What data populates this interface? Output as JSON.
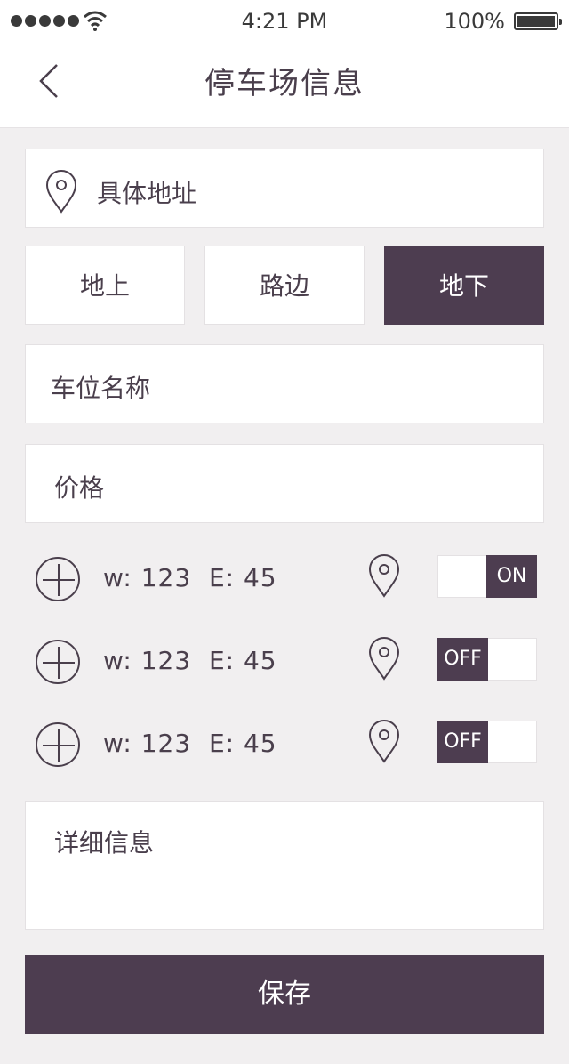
{
  "status_bar": {
    "time": "4:21 PM",
    "battery": "100%"
  },
  "header": {
    "title": "停车场信息",
    "back_icon": "chevron-left-icon"
  },
  "address": {
    "label": "具体地址",
    "icon": "location-pin-icon"
  },
  "location_type": {
    "options": [
      "地上",
      "路边",
      "地下"
    ],
    "selected": "地下"
  },
  "space_name": {
    "placeholder": "车位名称"
  },
  "price": {
    "placeholder": "价格"
  },
  "points": [
    {
      "coords": "w: 123  E: 45",
      "toggle": "ON"
    },
    {
      "coords": "w: 123  E: 45",
      "toggle": "OFF"
    },
    {
      "coords": "w: 123  E: 45",
      "toggle": "OFF"
    }
  ],
  "details": {
    "placeholder": "详细信息"
  },
  "save": {
    "label": "保存"
  },
  "colors": {
    "accent": "#4d3d50",
    "background": "#f1eff0",
    "text": "#4a3f4c"
  }
}
